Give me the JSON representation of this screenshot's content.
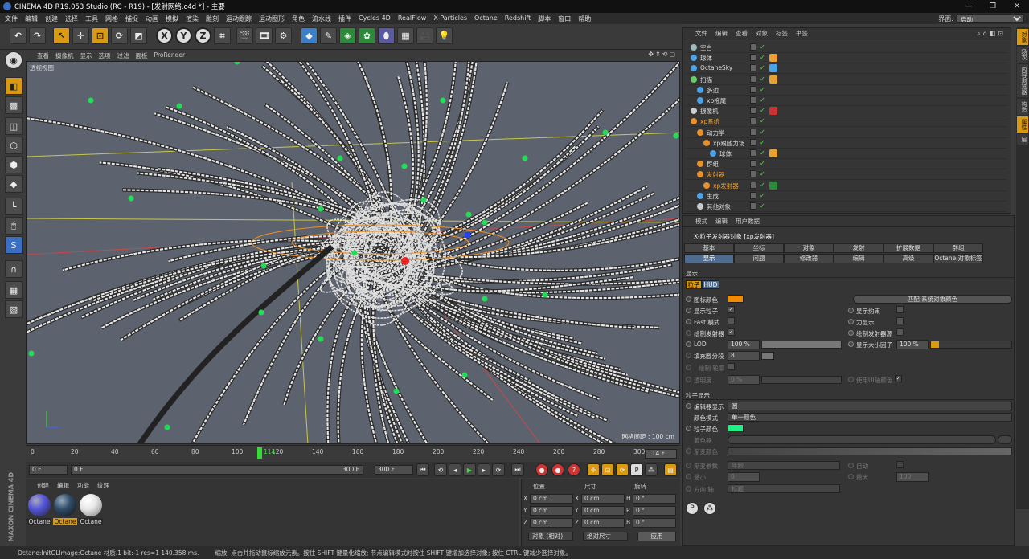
{
  "window": {
    "title": "CINEMA 4D R19.053 Studio (RC - R19) - [发射网络.c4d *] - 主要",
    "min": "—",
    "max": "❐",
    "close": "✕"
  },
  "menu": [
    "文件",
    "编辑",
    "创建",
    "选择",
    "工具",
    "网格",
    "捕捉",
    "动画",
    "模拟",
    "渲染",
    "雕刻",
    "运动跟踪",
    "运动图形",
    "角色",
    "流水线",
    "插件",
    "Cycles 4D",
    "RealFlow",
    "X-Particles",
    "Octane",
    "Redshift",
    "脚本",
    "窗口",
    "帮助"
  ],
  "interface": {
    "label": "界面:",
    "value": "启动"
  },
  "viewport": {
    "menu": [
      "查看",
      "摄像机",
      "显示",
      "选项",
      "过滤",
      "面板",
      "ProRender"
    ],
    "label": "透视视图",
    "grid": "网格间距 : 100 cm",
    "nav_icons": "✥⇕⟲▢"
  },
  "timeline": {
    "ticks": [
      "0",
      "20",
      "40",
      "60",
      "80",
      "100",
      "120",
      "140",
      "160",
      "180",
      "200",
      "220",
      "240",
      "260",
      "280",
      "300"
    ],
    "current": "114",
    "end": "114 F"
  },
  "playbar": {
    "start": "0 F",
    "range_start": "0 F",
    "range_end": "300 F",
    "end": "300 F"
  },
  "materials": {
    "menu": [
      "创建",
      "编辑",
      "功能",
      "纹理"
    ],
    "items": [
      {
        "name": "Octane",
        "color": "#5555dd"
      },
      {
        "name": "Octane",
        "color": "#2f4d6a"
      },
      {
        "name": "Octane",
        "color": "#e8e8e8"
      }
    ]
  },
  "coords": {
    "headers": [
      "位置",
      "尺寸",
      "旋转"
    ],
    "rows": [
      {
        "a": "X",
        "v1": "0 cm",
        "b": "X",
        "v2": "0 cm",
        "c": "H",
        "v3": "0 °"
      },
      {
        "a": "Y",
        "v1": "0 cm",
        "b": "Y",
        "v2": "0 cm",
        "c": "P",
        "v3": "0 °"
      },
      {
        "a": "Z",
        "v1": "0 cm",
        "b": "Z",
        "v2": "0 cm",
        "c": "B",
        "v3": "0 °"
      }
    ],
    "mode": "对象 (相对)",
    "size_mode": "绝对尺寸",
    "apply": "应用"
  },
  "status": [
    "Octane:InitGLImage:Octane 材质.1  bit:-1 res=1  140.358 ms.",
    "缩放: 点击并拖动鼠标缩放元素。按住 SHIFT 键量化缩放; 节点编辑模式时按住 SHIFT 键增加选择对象; 按住 CTRL 键减少选择对象。"
  ],
  "maxon": "MAXON CINEMA 4D",
  "objects": {
    "menu": [
      "文件",
      "编辑",
      "查看",
      "对象",
      "标签",
      "书签"
    ],
    "icons": "⌕⌂◧⊡",
    "rows": [
      {
        "name": "空白",
        "indent": 0,
        "color": "#9bb",
        "hl": false
      },
      {
        "name": "球体",
        "indent": 0,
        "color": "#4aa3e8",
        "hl": false
      },
      {
        "name": "OctaneSky",
        "indent": 0,
        "color": "#4aa3e8",
        "hl": false
      },
      {
        "name": "扫描",
        "indent": 0,
        "color": "#6c6",
        "hl": false
      },
      {
        "name": "多边",
        "indent": 1,
        "color": "#4aa3e8",
        "hl": false
      },
      {
        "name": "xp拖尾",
        "indent": 1,
        "color": "#4aa3e8",
        "hl": false
      },
      {
        "name": "摄像机",
        "indent": 0,
        "color": "#ccc",
        "hl": false
      },
      {
        "name": "xp系统",
        "indent": 0,
        "color": "#e8902a",
        "hl": true
      },
      {
        "name": "动力学",
        "indent": 1,
        "color": "#e8902a",
        "hl": false
      },
      {
        "name": "xp跟随力场",
        "indent": 2,
        "color": "#e8902a",
        "hl": false
      },
      {
        "name": "球体",
        "indent": 3,
        "color": "#4aa3e8",
        "hl": false
      },
      {
        "name": "群组",
        "indent": 1,
        "color": "#e8902a",
        "hl": false
      },
      {
        "name": "发射器",
        "indent": 1,
        "color": "#e8902a",
        "hl": true
      },
      {
        "name": "xp发射器",
        "indent": 2,
        "color": "#e8902a",
        "hl": true
      },
      {
        "name": "生成",
        "indent": 1,
        "color": "#4aa3e8",
        "hl": false
      },
      {
        "name": "其他对象",
        "indent": 1,
        "color": "#ccc",
        "hl": false
      }
    ]
  },
  "right_tabs": [
    "对象",
    "场次",
    "内容浏览器",
    "构造",
    "属性",
    "层"
  ],
  "attr": {
    "menu": [
      "模式",
      "编辑",
      "用户数据"
    ],
    "title": "X-粒子发射器对象 [xp发射器]",
    "tabs1": [
      "基本",
      "坐标",
      "对象",
      "发射",
      "扩展数据",
      "群组"
    ],
    "tabs2": [
      "显示",
      "问题",
      "修改器",
      "编辑",
      "高级",
      "Octane 对象标签"
    ],
    "section": "显示",
    "subtabs": [
      "粒子",
      "HUD"
    ],
    "icon_color_label": "图标颜色",
    "icon_color": "#f08a00",
    "match_btn": "匹配 系统对象颜色",
    "show_particles": "显示粒子",
    "show_constraints": "显示约束",
    "fast_mode": "Fast 模式",
    "force_display": "力显示",
    "draw_emitter": "绘制发射器",
    "draw_emitter_source": "绘制发射器源",
    "lod": "LOD",
    "lod_val": "100 %",
    "size_factor": "显示大小因子",
    "size_factor_val": "100 %",
    "fill_sub": "填充圆分段",
    "fill_val": "8",
    "draw_outline": "绘制 轮廓",
    "transp": "透明度",
    "transp_val": "0 %",
    "use_ui_color": "使用UI轴颜色",
    "section2": "粒子显示",
    "editor_display": "编辑器显示",
    "editor_val": "圆",
    "color_mode": "颜色模式",
    "color_mode_val": "单一颜色",
    "particle_color": "粒子颜色",
    "particle_color_val": "#22ee88",
    "shader": "着色器",
    "gradient": "渐变颜色",
    "gradient_param": "渐变参数",
    "gradient_param_val": "年龄",
    "auto": "自动",
    "min": "最小",
    "min_val": "0",
    "max": "最大",
    "max_val": "100",
    "direction": "方向 轴",
    "direction_val": "标题",
    "check": "✓"
  }
}
